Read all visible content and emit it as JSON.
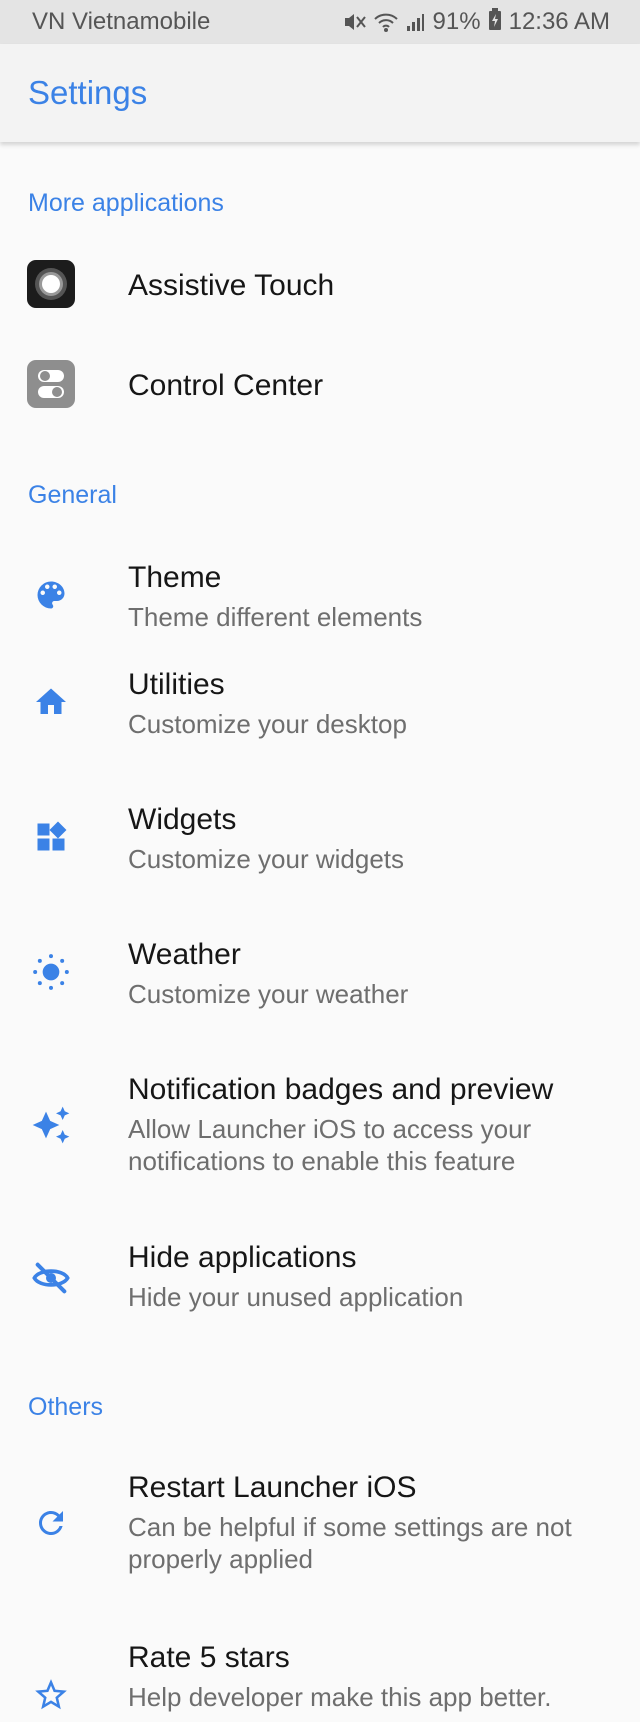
{
  "status_bar": {
    "carrier": "VN Vietnamobile",
    "battery": "91%",
    "time": "12:36 AM"
  },
  "app_bar": {
    "title": "Settings"
  },
  "sections": {
    "more_apps": {
      "header": "More applications",
      "items": [
        {
          "title": "Assistive Touch",
          "icon": "assistive-touch-icon"
        },
        {
          "title": "Control Center",
          "icon": "control-center-icon"
        }
      ]
    },
    "general": {
      "header": "General",
      "items": [
        {
          "title": "Theme",
          "subtitle": "Theme different elements",
          "icon": "palette-icon"
        },
        {
          "title": "Utilities",
          "subtitle": "Customize your desktop",
          "icon": "home-icon"
        },
        {
          "title": "Widgets",
          "subtitle": "Customize your widgets",
          "icon": "widgets-icon"
        },
        {
          "title": "Weather",
          "subtitle": "Customize your weather",
          "icon": "sun-icon"
        },
        {
          "title": "Notification badges and preview",
          "subtitle": "Allow Launcher iOS to access your notifications to enable this feature",
          "icon": "sparkle-icon"
        },
        {
          "title": "Hide applications",
          "subtitle": "Hide your unused application",
          "icon": "eye-off-icon"
        }
      ]
    },
    "others": {
      "header": "Others",
      "items": [
        {
          "title": "Restart Launcher iOS",
          "subtitle": "Can be helpful if some settings are not properly applied",
          "icon": "refresh-icon"
        },
        {
          "title": "Rate 5 stars",
          "subtitle": "Help developer make this app better.",
          "icon": "star-icon"
        }
      ]
    }
  },
  "colors": {
    "accent": "#3b82e6",
    "background": "#fafafa",
    "status_bar": "#e4e4e4"
  }
}
